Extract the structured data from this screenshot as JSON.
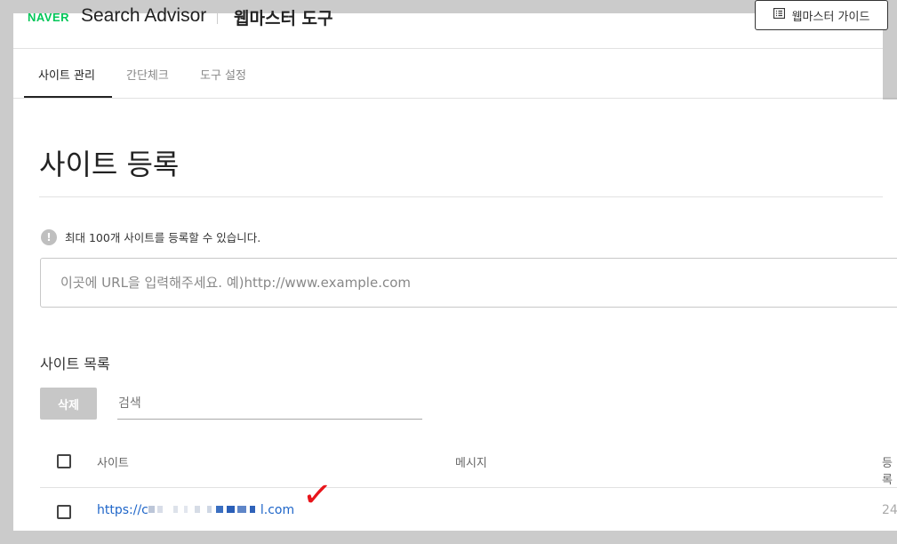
{
  "header": {
    "brand": "NAVER",
    "product": "Search Advisor",
    "section": "웹마스터 도구",
    "guide_button": "웹마스터 가이드"
  },
  "tabs": [
    {
      "label": "사이트 관리",
      "active": true
    },
    {
      "label": "간단체크",
      "active": false
    },
    {
      "label": "도구 설정",
      "active": false
    }
  ],
  "page": {
    "title": "사이트 등록",
    "info_text": "최대 100개 사이트를 등록할 수 있습니다.",
    "url_placeholder": "이곳에 URL을 입력해주세요. 예)http://www.example.com"
  },
  "site_list": {
    "title": "사이트 목록",
    "delete_button": "삭제",
    "search_placeholder": "검색",
    "columns": [
      "사이트",
      "메시지",
      "등록"
    ],
    "rows": [
      {
        "site_prefix": "https://c",
        "site_suffix": "l.com",
        "date_peek": "24"
      }
    ]
  },
  "colors": {
    "brand_green": "#03c75a",
    "link_blue": "#1f66c9",
    "annotation_red": "#e8151b"
  },
  "annotation": "✓"
}
